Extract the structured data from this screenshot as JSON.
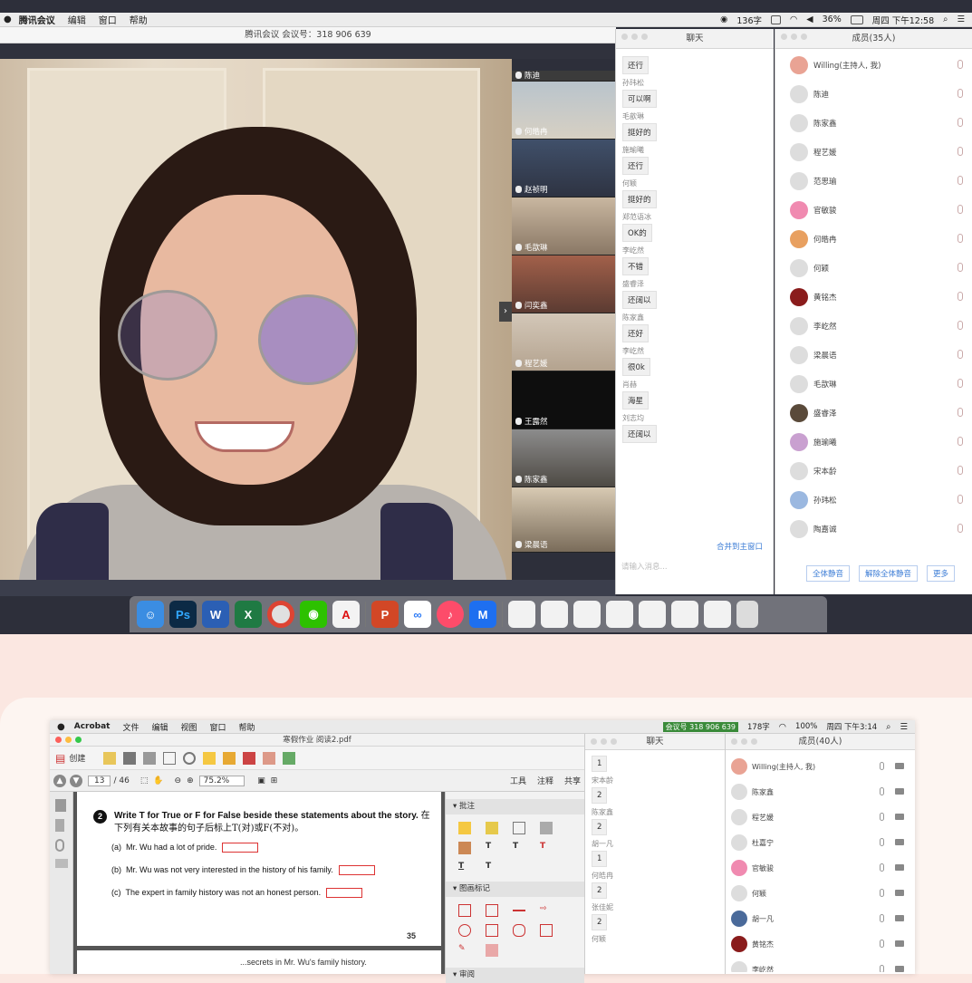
{
  "top": {
    "menubar": {
      "app": "腾讯会议",
      "items": [
        "编辑",
        "窗口",
        "帮助"
      ],
      "chars": "136字",
      "battery": "36%",
      "datetime": "周四 下午12:58"
    },
    "meeting_title": "腾讯会议 会议号：318 906 639",
    "thumbnails": [
      "陈迪",
      "何皓冉",
      "赵祯明",
      "毛歆琳",
      "闫奕鑫",
      "程艺媛",
      "王露然",
      "陈家鑫",
      "梁晨语"
    ],
    "chat": {
      "title": "聊天",
      "first_bubble": "还行",
      "messages": [
        {
          "sender": "孙玮松",
          "text": "可以啊"
        },
        {
          "sender": "毛歆琳",
          "text": "挺好的"
        },
        {
          "sender": "施瑜曦",
          "text": "还行"
        },
        {
          "sender": "何颖",
          "text": "挺好的"
        },
        {
          "sender": "郑范语冰",
          "text": "OK的"
        },
        {
          "sender": "李屹然",
          "text": "不错"
        },
        {
          "sender": "盛睿泽",
          "text": "还阔以"
        },
        {
          "sender": "陈家鑫",
          "text": "还好"
        },
        {
          "sender": "李屹然",
          "text": "很0k"
        },
        {
          "sender": "肖赫",
          "text": "海星"
        },
        {
          "sender": "刘志均",
          "text": "还阔以"
        }
      ],
      "merge_link": "合并到主窗口",
      "input_placeholder": "请输入消息..."
    },
    "members": {
      "title": "成员(35人)",
      "list": [
        "Willing(主持人, 我)",
        "陈迪",
        "陈家鑫",
        "程艺媛",
        "范思瑜",
        "官敏骏",
        "何皓冉",
        "何颖",
        "黄铭杰",
        "李屹然",
        "梁晨语",
        "毛歆琳",
        "盛睿泽",
        "施瑜曦",
        "宋本龄",
        "孙玮松",
        "陶嘉诚"
      ],
      "buttons": [
        "全体静音",
        "解除全体静音",
        "更多"
      ]
    }
  },
  "bottom": {
    "menubar": {
      "app": "Acrobat",
      "items": [
        "文件",
        "编辑",
        "视图",
        "窗口",
        "帮助"
      ],
      "meeting_badge": "会议号 318 906 639",
      "chars": "178字",
      "battery": "100%",
      "datetime": "周四 下午3:14"
    },
    "doc_title": "寒假作业 阅读2.pdf",
    "toolbar": {
      "create": "创建",
      "page_current": "13",
      "page_total": "/ 46",
      "zoom": "75.2%",
      "tabs": [
        "工具",
        "注释",
        "共享"
      ]
    },
    "pdf": {
      "q_num": "2",
      "q_title": "Write T for True or F for False beside these statements about the story.",
      "q_title_cn": "在下列有关本故事的句子后标上T(对)或F(不对)。",
      "statements": [
        {
          "label": "(a)",
          "text": "Mr. Wu had a lot of pride."
        },
        {
          "label": "(b)",
          "text": "Mr. Wu was not very interested in the history of his family."
        },
        {
          "label": "(c)",
          "text": "The expert in family history was not an honest person."
        }
      ],
      "page_number": "35",
      "next_line": "...secrets in Mr. Wu's family history."
    },
    "panels": [
      "批注",
      "图画标记",
      "审阅"
    ],
    "chat": {
      "title": "聊天",
      "first": "1",
      "messages": [
        {
          "sender": "宋本龄",
          "text": "2"
        },
        {
          "sender": "陈家鑫",
          "text": "2"
        },
        {
          "sender": "胡一凡",
          "text": "1"
        },
        {
          "sender": "何皓冉",
          "text": "2"
        },
        {
          "sender": "张佳妮",
          "text": "2"
        },
        {
          "sender": "何颖",
          "text": ""
        }
      ]
    },
    "members": {
      "title": "成员(40人)",
      "list": [
        "Willing(主持人, 我)",
        "陈家鑫",
        "程艺媛",
        "杜嘉宁",
        "官敏骏",
        "何颖",
        "胡一凡",
        "黄铭杰",
        "李屹然"
      ]
    }
  }
}
